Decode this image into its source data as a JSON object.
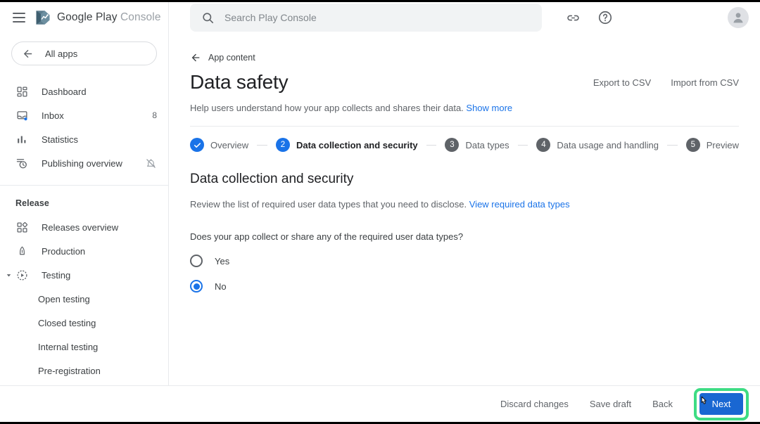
{
  "brand": {
    "name_bold": "Google Play",
    "name_light": "Console"
  },
  "sidebar": {
    "all_apps_label": "All apps",
    "items": [
      {
        "label": "Dashboard",
        "icon": "dashboard-icon",
        "badge": ""
      },
      {
        "label": "Inbox",
        "icon": "inbox-icon",
        "badge": "8"
      },
      {
        "label": "Statistics",
        "icon": "statistics-icon",
        "badge": ""
      },
      {
        "label": "Publishing overview",
        "icon": "publishing-overview-icon",
        "badge": ""
      }
    ],
    "section_title": "Release",
    "release_items": [
      {
        "label": "Releases overview",
        "icon": "releases-overview-icon"
      },
      {
        "label": "Production",
        "icon": "production-icon"
      },
      {
        "label": "Testing",
        "icon": "testing-icon"
      }
    ],
    "testing_children": [
      {
        "label": "Open testing"
      },
      {
        "label": "Closed testing"
      },
      {
        "label": "Internal testing"
      },
      {
        "label": "Pre-registration"
      }
    ]
  },
  "topbar": {
    "search_placeholder": "Search Play Console",
    "search_value": "",
    "icons": [
      "link-icon",
      "help-icon",
      "account-avatar"
    ]
  },
  "page": {
    "back_label": "App content",
    "title": "Data safety",
    "description": "Help users understand how your app collects and shares their data.",
    "description_link": "Show more",
    "export_label": "Export to CSV",
    "import_label": "Import from CSV"
  },
  "stepper": {
    "steps": [
      {
        "number": "✓",
        "label": "Overview",
        "state": "done"
      },
      {
        "number": "2",
        "label": "Data collection and security",
        "state": "current"
      },
      {
        "number": "3",
        "label": "Data types",
        "state": "todo"
      },
      {
        "number": "4",
        "label": "Data usage and handling",
        "state": "todo"
      },
      {
        "number": "5",
        "label": "Preview",
        "state": "todo"
      }
    ]
  },
  "section": {
    "heading": "Data collection and security",
    "subtext": "Review the list of required user data types that you need to disclose.",
    "subtext_link": "View required data types",
    "question": "Does your app collect or share any of the required user data types?",
    "options": [
      {
        "label": "Yes",
        "selected": false
      },
      {
        "label": "No",
        "selected": true
      }
    ]
  },
  "footer": {
    "discard_label": "Discard changes",
    "save_label": "Save draft",
    "back_label": "Back",
    "next_label": "Next"
  },
  "colors": {
    "accent_blue": "#1a73e8",
    "button_blue": "#1967d2",
    "highlight_green": "#3ddc84",
    "text_primary": "#202124",
    "text_secondary": "#5f6368",
    "divider": "#e8eaed"
  }
}
